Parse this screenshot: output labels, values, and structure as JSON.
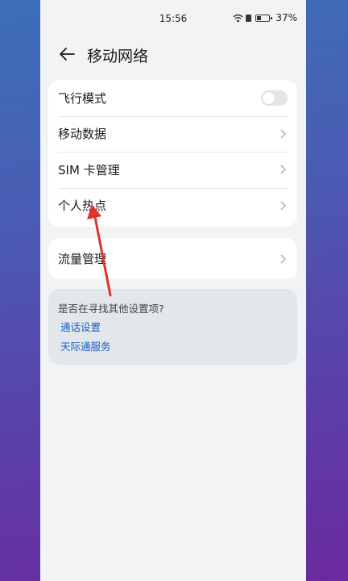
{
  "status_bar": {
    "time": "15:56",
    "battery_percent": "37%",
    "battery_level": 0.37,
    "icons": [
      "wifi-icon",
      "sim-badge-icon",
      "battery-icon"
    ]
  },
  "header": {
    "title": "移动网络",
    "back_icon": "arrow-left-icon"
  },
  "settings": [
    {
      "label": "飞行模式",
      "control": "toggle",
      "value": false
    },
    {
      "label": "移动数据",
      "control": "chevron"
    },
    {
      "label": "SIM 卡管理",
      "control": "chevron"
    },
    {
      "label": "个人热点",
      "control": "chevron"
    }
  ],
  "traffic": {
    "label": "流量管理",
    "control": "chevron"
  },
  "suggestions": {
    "title": "是否在寻找其他设置项?",
    "links": [
      "通话设置",
      "天际通服务"
    ]
  },
  "annotation": {
    "color": "#e0322c",
    "icon": "red-arrow-annotation"
  },
  "colors": {
    "accent_link": "#1a5fcc",
    "page_bg": "#f1f3f5"
  }
}
